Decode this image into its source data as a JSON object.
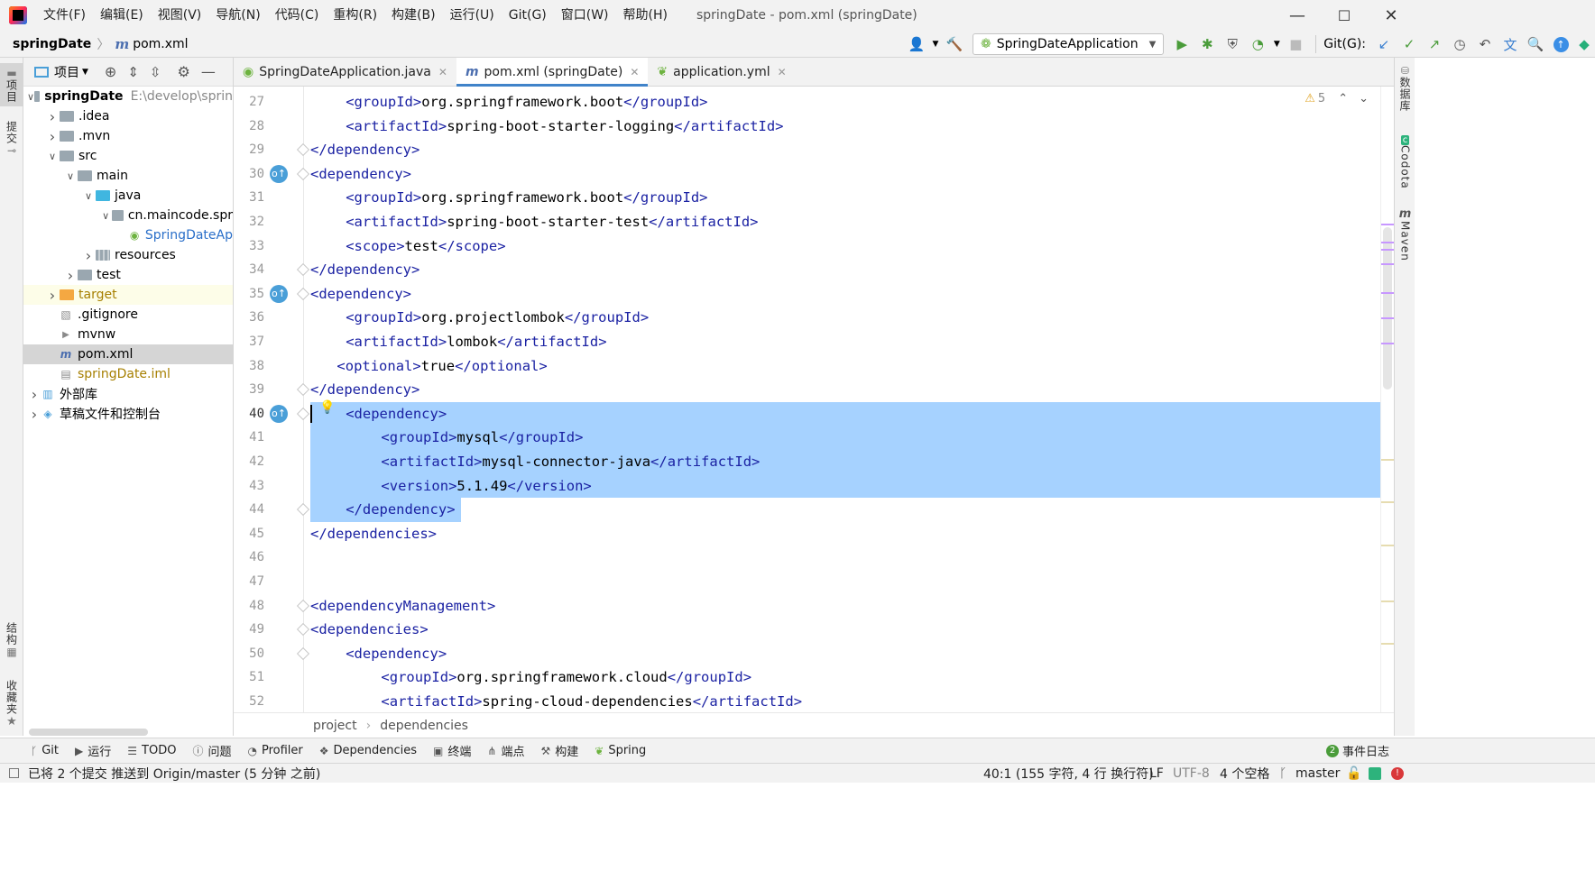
{
  "titlebar": {
    "menu": [
      "文件(F)",
      "编辑(E)",
      "视图(V)",
      "导航(N)",
      "代码(C)",
      "重构(R)",
      "构建(B)",
      "运行(U)",
      "Git(G)",
      "窗口(W)",
      "帮助(H)"
    ],
    "title": "springDate - pom.xml (springDate)",
    "minimize": "—",
    "maximize": "☐",
    "close": "✕"
  },
  "navbar": {
    "project": "springDate",
    "file_icon": "m",
    "file": "pom.xml"
  },
  "toolbar": {
    "run_config": "SpringDateApplication",
    "git_label": "Git(G):"
  },
  "left_strip": {
    "project": "项目",
    "commit": "提交",
    "structure": "结构",
    "favorites": "收藏夹"
  },
  "project_panel": {
    "title": "项目",
    "tree": [
      {
        "label": "springDate",
        "extra": "E:\\develop\\sprin",
        "depth": 0,
        "chev": "open",
        "icon": "module",
        "bold": true
      },
      {
        "label": ".idea",
        "depth": 1,
        "chev": "closed",
        "icon": "folder-gray"
      },
      {
        "label": ".mvn",
        "depth": 1,
        "chev": "closed",
        "icon": "folder-gray"
      },
      {
        "label": "src",
        "depth": 1,
        "chev": "open",
        "icon": "folder-gray"
      },
      {
        "label": "main",
        "depth": 2,
        "chev": "open",
        "icon": "folder-gray"
      },
      {
        "label": "java",
        "depth": 3,
        "chev": "open",
        "icon": "folder-blue"
      },
      {
        "label": "cn.maincode.spr",
        "depth": 4,
        "chev": "open",
        "icon": "package"
      },
      {
        "label": "SpringDateAp",
        "depth": 5,
        "chev": "none",
        "icon": "spring-class",
        "color": "#2a6fc9"
      },
      {
        "label": "resources",
        "depth": 3,
        "chev": "closed",
        "icon": "folder-res"
      },
      {
        "label": "test",
        "depth": 2,
        "chev": "closed",
        "icon": "folder-gray"
      },
      {
        "label": "target",
        "depth": 1,
        "chev": "closed",
        "icon": "folder-orange",
        "color": "#a67f00",
        "highlight": true
      },
      {
        "label": ".gitignore",
        "depth": 1,
        "chev": "none",
        "icon": "gitignore"
      },
      {
        "label": "mvnw",
        "depth": 1,
        "chev": "none",
        "icon": "script"
      },
      {
        "label": "pom.xml",
        "depth": 1,
        "chev": "none",
        "icon": "maven",
        "selected": true
      },
      {
        "label": "springDate.iml",
        "depth": 1,
        "chev": "none",
        "icon": "iml",
        "color": "#a67f00"
      },
      {
        "label": "外部库",
        "depth": 0,
        "chev": "closed",
        "icon": "library"
      },
      {
        "label": "草稿文件和控制台",
        "depth": 0,
        "chev": "closed",
        "icon": "scratch"
      }
    ]
  },
  "tabs": [
    {
      "label": "SpringDateApplication.java",
      "icon": "spring-class",
      "active": false
    },
    {
      "label": "pom.xml (springDate)",
      "icon": "maven",
      "active": true
    },
    {
      "label": "application.yml",
      "icon": "yml",
      "active": false
    }
  ],
  "editor": {
    "warnings": "5",
    "lines": [
      {
        "n": "27",
        "indent": 1,
        "parts": [
          [
            "<",
            "t"
          ],
          [
            "groupId",
            "t"
          ],
          [
            ">",
            "t"
          ],
          [
            "org.springframework.boot",
            "x"
          ],
          [
            "</",
            "t"
          ],
          [
            "groupId",
            "t"
          ],
          [
            ">",
            "t"
          ]
        ]
      },
      {
        "n": "28",
        "indent": 1,
        "parts": [
          [
            "<",
            "t"
          ],
          [
            "artifactId",
            "t"
          ],
          [
            ">",
            "t"
          ],
          [
            "spring-boot-starter-logging",
            "x"
          ],
          [
            "</",
            "t"
          ],
          [
            "artifactId",
            "t"
          ],
          [
            ">",
            "t"
          ]
        ]
      },
      {
        "n": "29",
        "indent": 0,
        "parts": [
          [
            "</",
            "t"
          ],
          [
            "dependency",
            "t"
          ],
          [
            ">",
            "t"
          ]
        ]
      },
      {
        "n": "30",
        "indent": 0,
        "parts": [
          [
            "<",
            "t"
          ],
          [
            "dependency",
            "t"
          ],
          [
            ">",
            "t"
          ]
        ],
        "icon": true
      },
      {
        "n": "31",
        "indent": 1,
        "parts": [
          [
            "<",
            "t"
          ],
          [
            "groupId",
            "t"
          ],
          [
            ">",
            "t"
          ],
          [
            "org.springframework.boot",
            "x"
          ],
          [
            "</",
            "t"
          ],
          [
            "groupId",
            "t"
          ],
          [
            ">",
            "t"
          ]
        ]
      },
      {
        "n": "32",
        "indent": 1,
        "parts": [
          [
            "<",
            "t"
          ],
          [
            "artifactId",
            "t"
          ],
          [
            ">",
            "t"
          ],
          [
            "spring-boot-starter-test",
            "x"
          ],
          [
            "</",
            "t"
          ],
          [
            "artifactId",
            "t"
          ],
          [
            ">",
            "t"
          ]
        ]
      },
      {
        "n": "33",
        "indent": 1,
        "parts": [
          [
            "<",
            "t"
          ],
          [
            "scope",
            "t"
          ],
          [
            ">",
            "t"
          ],
          [
            "test",
            "x"
          ],
          [
            "</",
            "t"
          ],
          [
            "scope",
            "t"
          ],
          [
            ">",
            "t"
          ]
        ]
      },
      {
        "n": "34",
        "indent": 0,
        "parts": [
          [
            "</",
            "t"
          ],
          [
            "dependency",
            "t"
          ],
          [
            ">",
            "t"
          ]
        ]
      },
      {
        "n": "35",
        "indent": 0,
        "parts": [
          [
            "<",
            "t"
          ],
          [
            "dependency",
            "t"
          ],
          [
            ">",
            "t"
          ]
        ],
        "icon": true
      },
      {
        "n": "36",
        "indent": 1,
        "parts": [
          [
            "<",
            "t"
          ],
          [
            "groupId",
            "t"
          ],
          [
            ">",
            "t"
          ],
          [
            "org.projectlombok",
            "x"
          ],
          [
            "</",
            "t"
          ],
          [
            "groupId",
            "t"
          ],
          [
            ">",
            "t"
          ]
        ]
      },
      {
        "n": "37",
        "indent": 1,
        "parts": [
          [
            "<",
            "t"
          ],
          [
            "artifactId",
            "t"
          ],
          [
            ">",
            "t"
          ],
          [
            "lombok",
            "x"
          ],
          [
            "</",
            "t"
          ],
          [
            "artifactId",
            "t"
          ],
          [
            ">",
            "t"
          ]
        ]
      },
      {
        "n": "38",
        "indent": 0.75,
        "parts": [
          [
            "<",
            "t"
          ],
          [
            "optional",
            "t"
          ],
          [
            ">",
            "t"
          ],
          [
            "true",
            "x"
          ],
          [
            "</",
            "t"
          ],
          [
            "optional",
            "t"
          ],
          [
            ">",
            "t"
          ]
        ]
      },
      {
        "n": "39",
        "indent": 0,
        "parts": [
          [
            "</",
            "t"
          ],
          [
            "dependency",
            "t"
          ],
          [
            ">",
            "t"
          ]
        ]
      },
      {
        "n": "40",
        "indent": 1,
        "parts": [
          [
            "<",
            "t"
          ],
          [
            "dependency",
            "t"
          ],
          [
            ">",
            "t"
          ]
        ],
        "icon": true,
        "sel": true,
        "caret": true
      },
      {
        "n": "41",
        "indent": 2,
        "parts": [
          [
            "<",
            "t"
          ],
          [
            "groupId",
            "t"
          ],
          [
            ">",
            "t"
          ],
          [
            "mysql",
            "x"
          ],
          [
            "</",
            "t"
          ],
          [
            "groupId",
            "t"
          ],
          [
            ">",
            "t"
          ]
        ],
        "sel": true
      },
      {
        "n": "42",
        "indent": 2,
        "parts": [
          [
            "<",
            "t"
          ],
          [
            "artifactId",
            "t"
          ],
          [
            ">",
            "t"
          ],
          [
            "mysql-connector-java",
            "x"
          ],
          [
            "</",
            "t"
          ],
          [
            "artifactId",
            "t"
          ],
          [
            ">",
            "t"
          ]
        ],
        "sel": true
      },
      {
        "n": "43",
        "indent": 2,
        "parts": [
          [
            "<",
            "t"
          ],
          [
            "version",
            "t"
          ],
          [
            ">",
            "t"
          ],
          [
            "5.1.49",
            "x"
          ],
          [
            "</",
            "t"
          ],
          [
            "version",
            "t"
          ],
          [
            ">",
            "t"
          ]
        ],
        "sel": true
      },
      {
        "n": "44",
        "indent": 1,
        "parts": [
          [
            "</",
            "t"
          ],
          [
            "dependency",
            "t"
          ],
          [
            ">",
            "t"
          ]
        ],
        "selpart": true
      },
      {
        "n": "45",
        "indent": 0,
        "parts": [
          [
            "</",
            "t"
          ],
          [
            "dependencies",
            "t"
          ],
          [
            ">",
            "t"
          ]
        ]
      },
      {
        "n": "46",
        "indent": 0,
        "parts": []
      },
      {
        "n": "47",
        "indent": 0,
        "parts": []
      },
      {
        "n": "48",
        "indent": 0,
        "parts": [
          [
            "<",
            "t"
          ],
          [
            "dependencyManagement",
            "t"
          ],
          [
            ">",
            "t"
          ]
        ]
      },
      {
        "n": "49",
        "indent": 0,
        "parts": [
          [
            "<",
            "t"
          ],
          [
            "dependencies",
            "t"
          ],
          [
            ">",
            "t"
          ]
        ]
      },
      {
        "n": "50",
        "indent": 1,
        "parts": [
          [
            "<",
            "t"
          ],
          [
            "dependency",
            "t"
          ],
          [
            ">",
            "t"
          ]
        ]
      },
      {
        "n": "51",
        "indent": 2,
        "parts": [
          [
            "<",
            "t"
          ],
          [
            "groupId",
            "t"
          ],
          [
            ">",
            "t"
          ],
          [
            "org.springframework.cloud",
            "x"
          ],
          [
            "</",
            "t"
          ],
          [
            "groupId",
            "t"
          ],
          [
            ">",
            "t"
          ]
        ]
      },
      {
        "n": "52",
        "indent": 2,
        "parts": [
          [
            "<",
            "t"
          ],
          [
            "artifactId",
            "t"
          ],
          [
            ">",
            "t"
          ],
          [
            "spring-cloud-dependencies",
            "x"
          ],
          [
            "</",
            "t"
          ],
          [
            "artifactId",
            "t"
          ],
          [
            ">",
            "t"
          ]
        ]
      }
    ]
  },
  "crumbs": [
    "project",
    "dependencies"
  ],
  "right_strip": {
    "database": "数据库",
    "codota": "Codota",
    "maven": "Maven"
  },
  "bottom_tabs": [
    "Git",
    "运行",
    "TODO",
    "问题",
    "Profiler",
    "Dependencies",
    "终端",
    "端点",
    "构建",
    "Spring"
  ],
  "event_log": {
    "count": "2",
    "label": "事件日志"
  },
  "status": {
    "message": "已将 2 个提交 推送到 Origin/master (5 分钟 之前)",
    "position": "40:1 (155 字符, 4 行 换行符)",
    "line_sep": "LF",
    "encoding": "UTF-8",
    "indent": "4 个空格",
    "branch": "master"
  }
}
